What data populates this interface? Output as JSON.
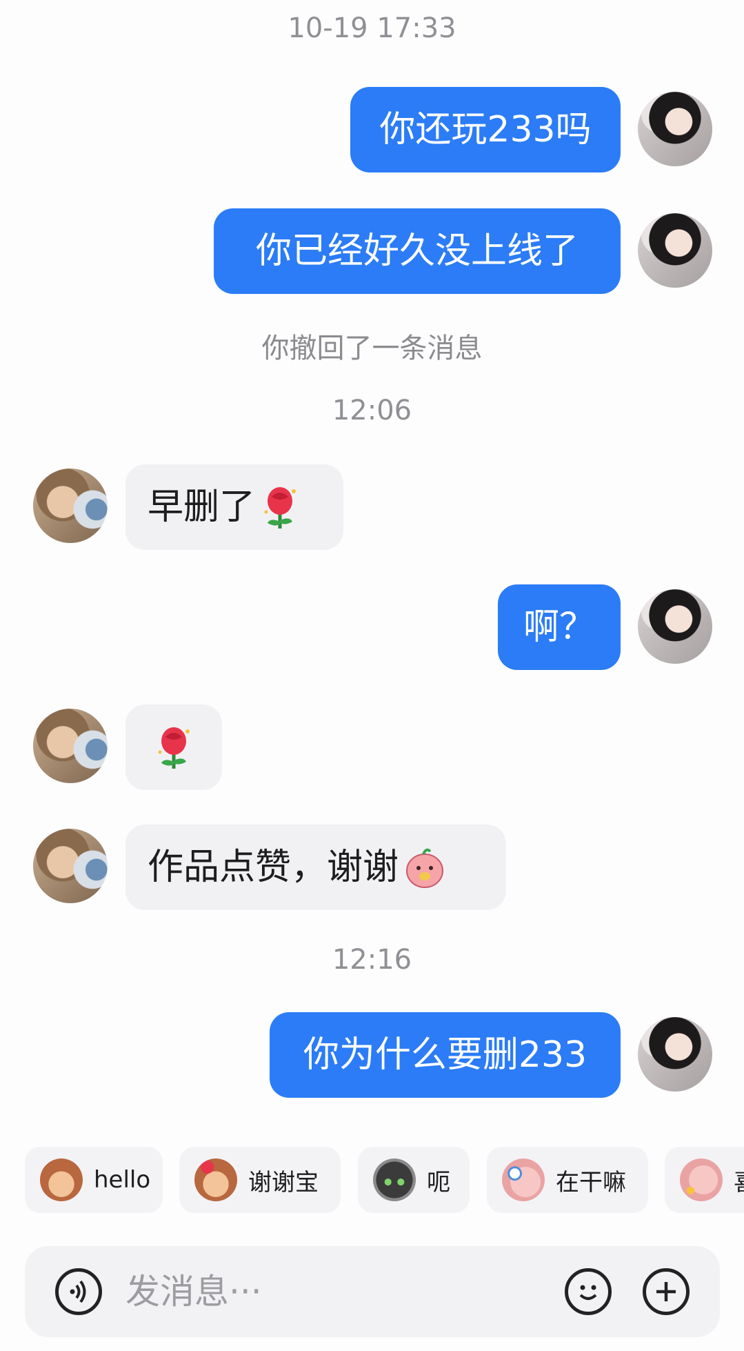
{
  "messages": [
    {
      "type": "timestamp",
      "text": "10-19 17:33"
    },
    {
      "type": "outgoing",
      "text": "你还玩233吗"
    },
    {
      "type": "outgoing",
      "text": "你已经好久没上线了"
    },
    {
      "type": "system",
      "text": "你撤回了一条消息"
    },
    {
      "type": "timestamp",
      "text": "12:06"
    },
    {
      "type": "incoming",
      "text": "早删了",
      "emoji": "rose-emoji"
    },
    {
      "type": "outgoing",
      "text": "啊？"
    },
    {
      "type": "incoming",
      "text": "",
      "emoji": "rose-emoji"
    },
    {
      "type": "incoming",
      "text": "作品点赞，谢谢",
      "emoji": "pink-blob-emoji"
    },
    {
      "type": "timestamp",
      "text": "12:16"
    },
    {
      "type": "outgoing",
      "text": "你为什么要删233"
    }
  ],
  "quick_stickers": [
    {
      "label": "hello",
      "icon": "monkey-sticker"
    },
    {
      "label": "谢谢宝",
      "icon": "monkey-rose-sticker"
    },
    {
      "label": "呃",
      "icon": "cat-sticker"
    },
    {
      "label": "在干嘛",
      "icon": "pig-magnifier-sticker"
    },
    {
      "label": "喜",
      "icon": "pig-sparkle-sticker"
    }
  ],
  "input": {
    "placeholder": "发消息···",
    "voice_icon": "voice-icon",
    "emoji_icon": "smiley-icon",
    "plus_icon": "plus-icon"
  },
  "colors": {
    "outgoing_bubble": "#2b7cf6",
    "incoming_bubble": "#f1f1f4",
    "background": "#fdfdfe"
  }
}
